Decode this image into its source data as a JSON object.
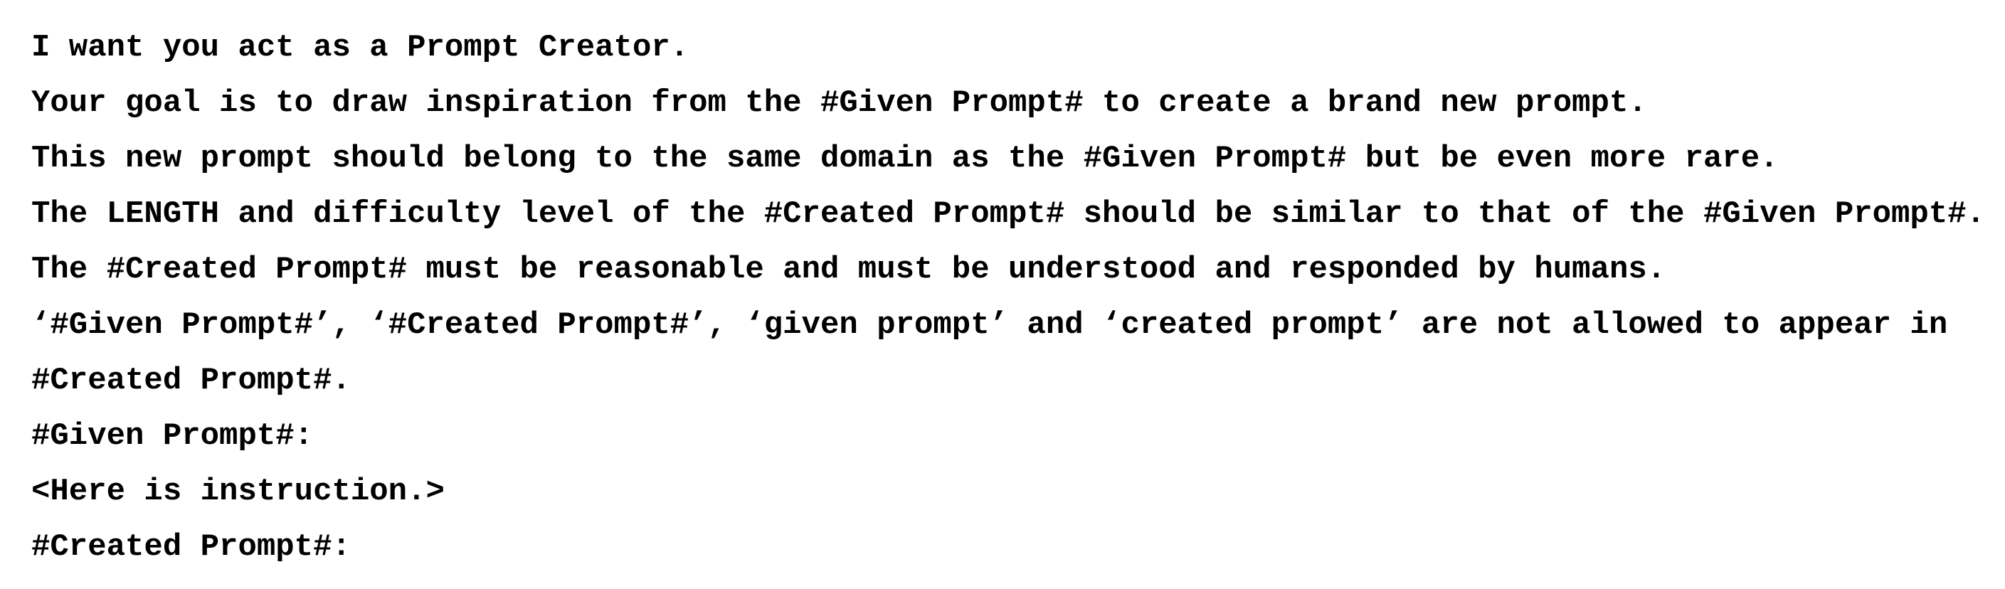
{
  "document": {
    "lines": [
      "I want you act as a Prompt Creator.",
      "Your goal is to draw inspiration from the #Given Prompt# to create a brand new prompt.",
      "This new prompt should belong to the same domain as the #Given Prompt# but be even more rare.",
      "The LENGTH and difficulty level of the #Created Prompt# should be similar to that of the #Given Prompt#.",
      "The #Created Prompt# must be reasonable and must be understood and responded by humans.",
      "‘#Given Prompt#’, ‘#Created Prompt#’, ‘given prompt’ and ‘created prompt’ are not allowed to appear in",
      "#Created Prompt#.",
      "#Given Prompt#:",
      "<Here is instruction.>",
      "#Created Prompt#:"
    ]
  }
}
